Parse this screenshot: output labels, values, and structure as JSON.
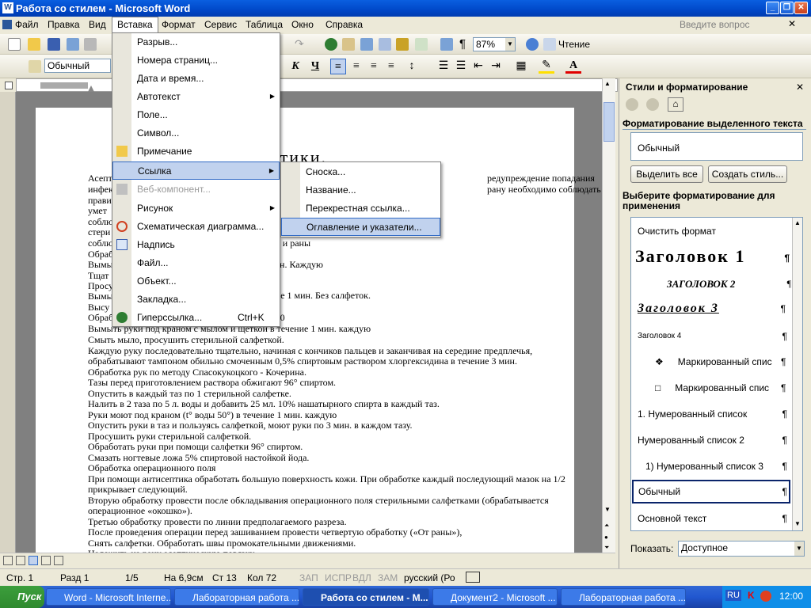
{
  "window": {
    "title": "Работа со стилем - Microsoft Word"
  },
  "menubar": {
    "items": [
      "Файл",
      "Правка",
      "Вид",
      "Вставка",
      "Формат",
      "Сервис",
      "Таблица",
      "Окно",
      "Справка"
    ],
    "ask": "Введите вопрос"
  },
  "toolbar": {
    "zoom": "87%",
    "read": "Чтение",
    "style": "Обычный"
  },
  "insert_menu": [
    {
      "label": "Разрыв..."
    },
    {
      "label": "Номера страниц..."
    },
    {
      "label": "Дата и время..."
    },
    {
      "label": "Автотекст"
    },
    {
      "label": "Поле..."
    },
    {
      "label": "Символ..."
    },
    {
      "label": "Примечание"
    },
    {
      "label": "Ссылка"
    },
    {
      "label": "Веб-компонент..."
    },
    {
      "label": "Рисунок"
    },
    {
      "label": "Схематическая диаграмма..."
    },
    {
      "label": "Надпись"
    },
    {
      "label": "Файл..."
    },
    {
      "label": "Объект..."
    },
    {
      "label": "Закладка..."
    },
    {
      "label": "Гиперссылка...",
      "shortcut": "Ctrl+K"
    }
  ],
  "link_submenu": [
    "Сноска...",
    "Название...",
    "Перекрестная ссылка...",
    "Оглавление и указатели..."
  ],
  "document": {
    "heading": "ы асептики.",
    "fragments": {
      "r1": "редупреждение попадания",
      "r2": "рану необходимо соблюдать",
      "r3": "поля и раны",
      "r4": "1 мин. Каждую",
      "r5": "чение 1 мин. Без салфеток.",
      "r6": "а 1:40"
    },
    "left_fragments": [
      "Асепт",
      "инфек",
      "прави",
      "умет",
      "соблю",
      "стери",
      "соблю",
      "Обраб",
      "Вымы",
      "Тщат",
      "Просу",
      "Вымы",
      "Высу",
      "Обраб",
      "Вымыть руки под краном с мылом и щеткой в течение 1 мин. каждую"
    ],
    "lines": [
      "Смыть мыло, просушить стерильной салфеткой.",
      "Каждую руку последовательно тщательно, начиная с кончиков пальцев и заканчивая на середине предплечья,",
      "обрабатывают тампоном обильно смоченным 0,5% спиртовым раствором хлоргексидина в течение 3 мин.",
      "Обработка рук по методу  Спасокукоцкого - Кочерина.",
      "Тазы перед приготовлением раствора обжигают 96° спиртом.",
      "Опустить в каждый таз по 1 стерильной салфетке.",
      "Налить в 2 таза по 5 л. воды и добавить 25 мл. 10% нашатырного спирта в каждый таз.",
      "Руки моют под краном (t° воды 50°) в течение 1 мин. каждую",
      "Опустить руки в таз и пользуясь салфеткой, моют руки по 3 мин. в каждом тазу.",
      "Просушить руки стерильной салфеткой.",
      "Обработать руки при помощи салфетки 96° спиртом.",
      "Смазать ногтевые ложа 5% спиртовой настойкой йода.",
      "Обработка операционного поля",
      "При помощи антисептика обработать большую поверхность кожи. При обработке каждый последующий мазок на 1/2",
      "прикрывает следующий.",
      "Вторую обработку провести после обкладывания операционного поля стерильными салфетками (обрабатывается",
      "операционное «окошко»).",
      "Третью обработку провести по линии предполагаемого разреза.",
      "После проведения операции перед зашиванием провести четвертую обработку («От раны»),",
      "Снять салфетки. Обработать швы промокательными движениями.",
      "Наложить на рану асептическую повязку."
    ]
  },
  "panel": {
    "title": "Стили и форматирование",
    "selected_heading": "Форматирование выделенного текста",
    "selected_value": "Обычный",
    "btn_select_all": "Выделить все",
    "btn_new_style": "Создать стиль...",
    "apply_heading": "Выберите форматирование для применения",
    "styles": [
      "Очистить формат",
      "Заголовок 1",
      "ЗАГОЛОВОК 2",
      "Заголовок 3",
      "Заголовок 4",
      "Маркированный спис",
      "Маркированный спис",
      "1.  Нумерованный список",
      "Нумерованный список 2",
      "1)  Нумерованный список 3",
      "Обычный",
      "Основной текст"
    ],
    "pilcrow": "¶",
    "show_label": "Показать:",
    "show_value": "Доступное"
  },
  "status": {
    "page": "Стр. 1",
    "section": "Разд 1",
    "pages": "1/5",
    "at": "На 6,9см",
    "line": "Ст 13",
    "col": "Кол 72",
    "rec": "ЗАП",
    "trk": "ИСПР",
    "ext": "ВДЛ",
    "ovr": "ЗАМ",
    "lang": "русский (Ро"
  },
  "taskbar": {
    "start": "Пуск",
    "tasks": [
      "Word - Microsoft Interne...",
      "Лабораторная работа ...",
      "Работа со стилем - М...",
      "Документ2 - Microsoft ...",
      "Лабораторная работа ..."
    ],
    "lang": "RU",
    "clock": "12:00"
  },
  "colors": {
    "titlebar": "#0a5fe0",
    "menu_highlight": "#c1d2ee",
    "taskbar": "#2157d0"
  }
}
